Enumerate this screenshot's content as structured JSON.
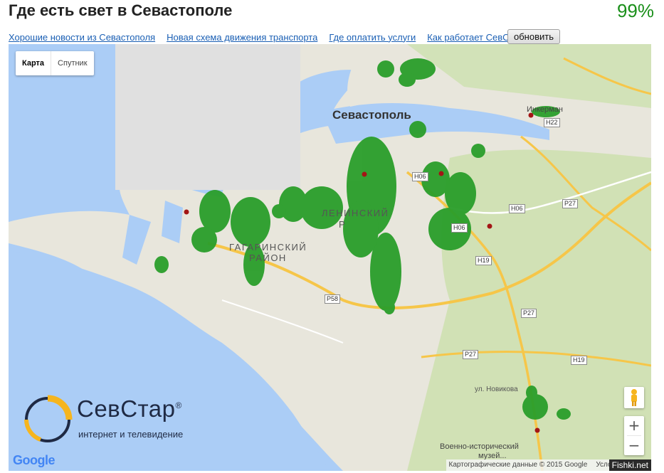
{
  "page": {
    "title": "Где есть свет в Севастополе",
    "percent": "99%"
  },
  "nav": {
    "links": [
      "Хорошие новости из Севастополя",
      "Новая схема движения транспорта",
      "Где оплатить услуги",
      "Как работает СевСтар"
    ],
    "refresh_label": "обновить"
  },
  "map": {
    "type_buttons": {
      "map": "Карта",
      "satellite": "Спутник"
    },
    "labels": {
      "city": "Севастополь",
      "district_gagarin_1": "ГАГАРИНСКИЙ",
      "district_gagarin_2": "РАЙОН",
      "district_lenin_1": "ЛЕНИНСКИЙ",
      "district_lenin_2": "Р",
      "street_novikova": "ул. Новикова",
      "museum_1": "Военно-исторический",
      "museum_2": "музей...",
      "inkerman": "Инкерман"
    },
    "road_badges": [
      "Н06",
      "Н06",
      "Н06",
      "Р27",
      "Н19",
      "Р58",
      "Р27",
      "Р27",
      "Н19",
      "Н22"
    ],
    "zoom": {
      "in": "+",
      "out": "−"
    },
    "google_logo": "Google",
    "attribution": "Картографические данные © 2015 Google",
    "terms": "Условия исполь",
    "watermark": "Fishki.net",
    "colors": {
      "water": "#abcdf6",
      "land": "#e8e6dc",
      "park": "#c9dfa8",
      "power_on": "#2a9e2a",
      "power_off": "#a31515"
    }
  },
  "brand": {
    "name": "СевСтар",
    "registered": "®",
    "tagline": "интернет и телевидение"
  }
}
